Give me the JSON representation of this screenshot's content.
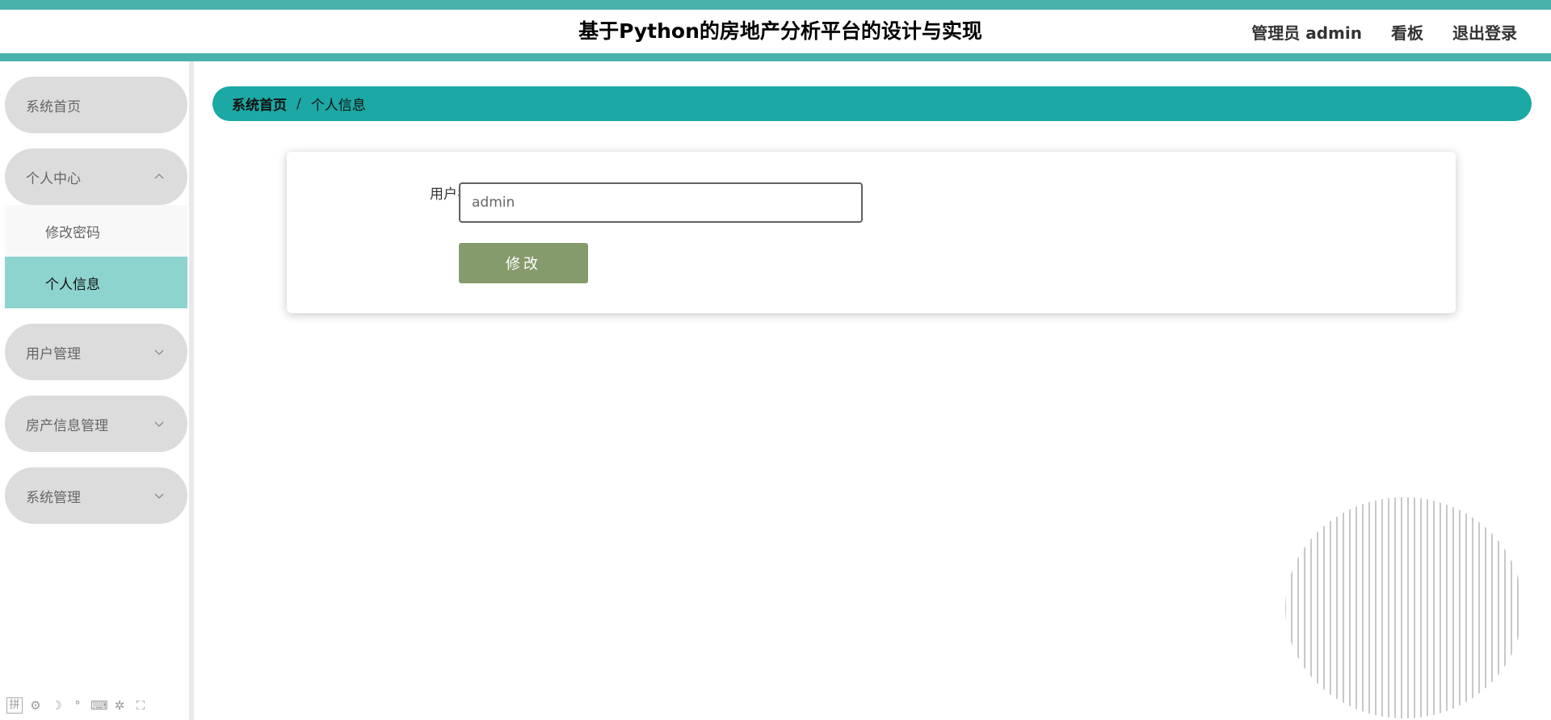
{
  "header": {
    "title": "基于Python的房地产分析平台的设计与实现",
    "admin_label": "管理员 admin",
    "dashboard_label": "看板",
    "logout_label": "退出登录"
  },
  "sidebar": {
    "items": [
      {
        "label": "系统首页"
      },
      {
        "label": "个人中心",
        "expanded": true,
        "children": [
          {
            "label": "修改密码"
          },
          {
            "label": "个人信息",
            "active": true
          }
        ]
      },
      {
        "label": "用户管理"
      },
      {
        "label": "房产信息管理"
      },
      {
        "label": "系统管理"
      }
    ]
  },
  "breadcrumb": {
    "home": "系统首页",
    "separator": "/",
    "current": "个人信息"
  },
  "form": {
    "username_label": "用户名",
    "username_value": "admin",
    "submit_label": "修改"
  },
  "ime_toolbar": {
    "icons": [
      "pinyin-icon",
      "settings-icon",
      "moon-icon",
      "punctuation-icon",
      "keyboard-icon",
      "gear-icon",
      "expand-icon"
    ],
    "first_glyph": "拼"
  },
  "colors": {
    "accent": "#48b2ab",
    "breadcrumb_bg": "#1ca8a4",
    "active_menu_bg": "#8dd3ce",
    "menu_bg": "#dcdcdc",
    "button_bg": "#869b6c"
  }
}
